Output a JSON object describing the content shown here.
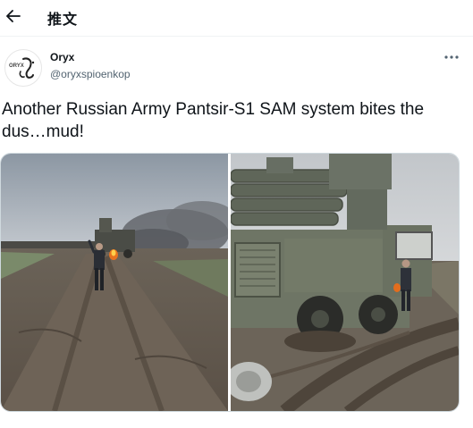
{
  "header": {
    "title": "推文",
    "back_icon": "arrow-left-icon"
  },
  "author": {
    "name": "Oryx",
    "handle": "@oryxspioenkop",
    "avatar_text": "ORYX",
    "more_icon": "more-horizontal-icon"
  },
  "tweet": {
    "text": "Another Russian Army Pantsir-S1 SAM system bites the dus…mud!"
  },
  "media": {
    "count": 2,
    "photos": [
      {
        "name": "photo-vehicle-on-fire-road"
      },
      {
        "name": "photo-vehicle-stuck-in-mud"
      }
    ]
  },
  "colors": {
    "text": "#0f1419",
    "muted": "#536471",
    "border": "#cfd9de"
  }
}
